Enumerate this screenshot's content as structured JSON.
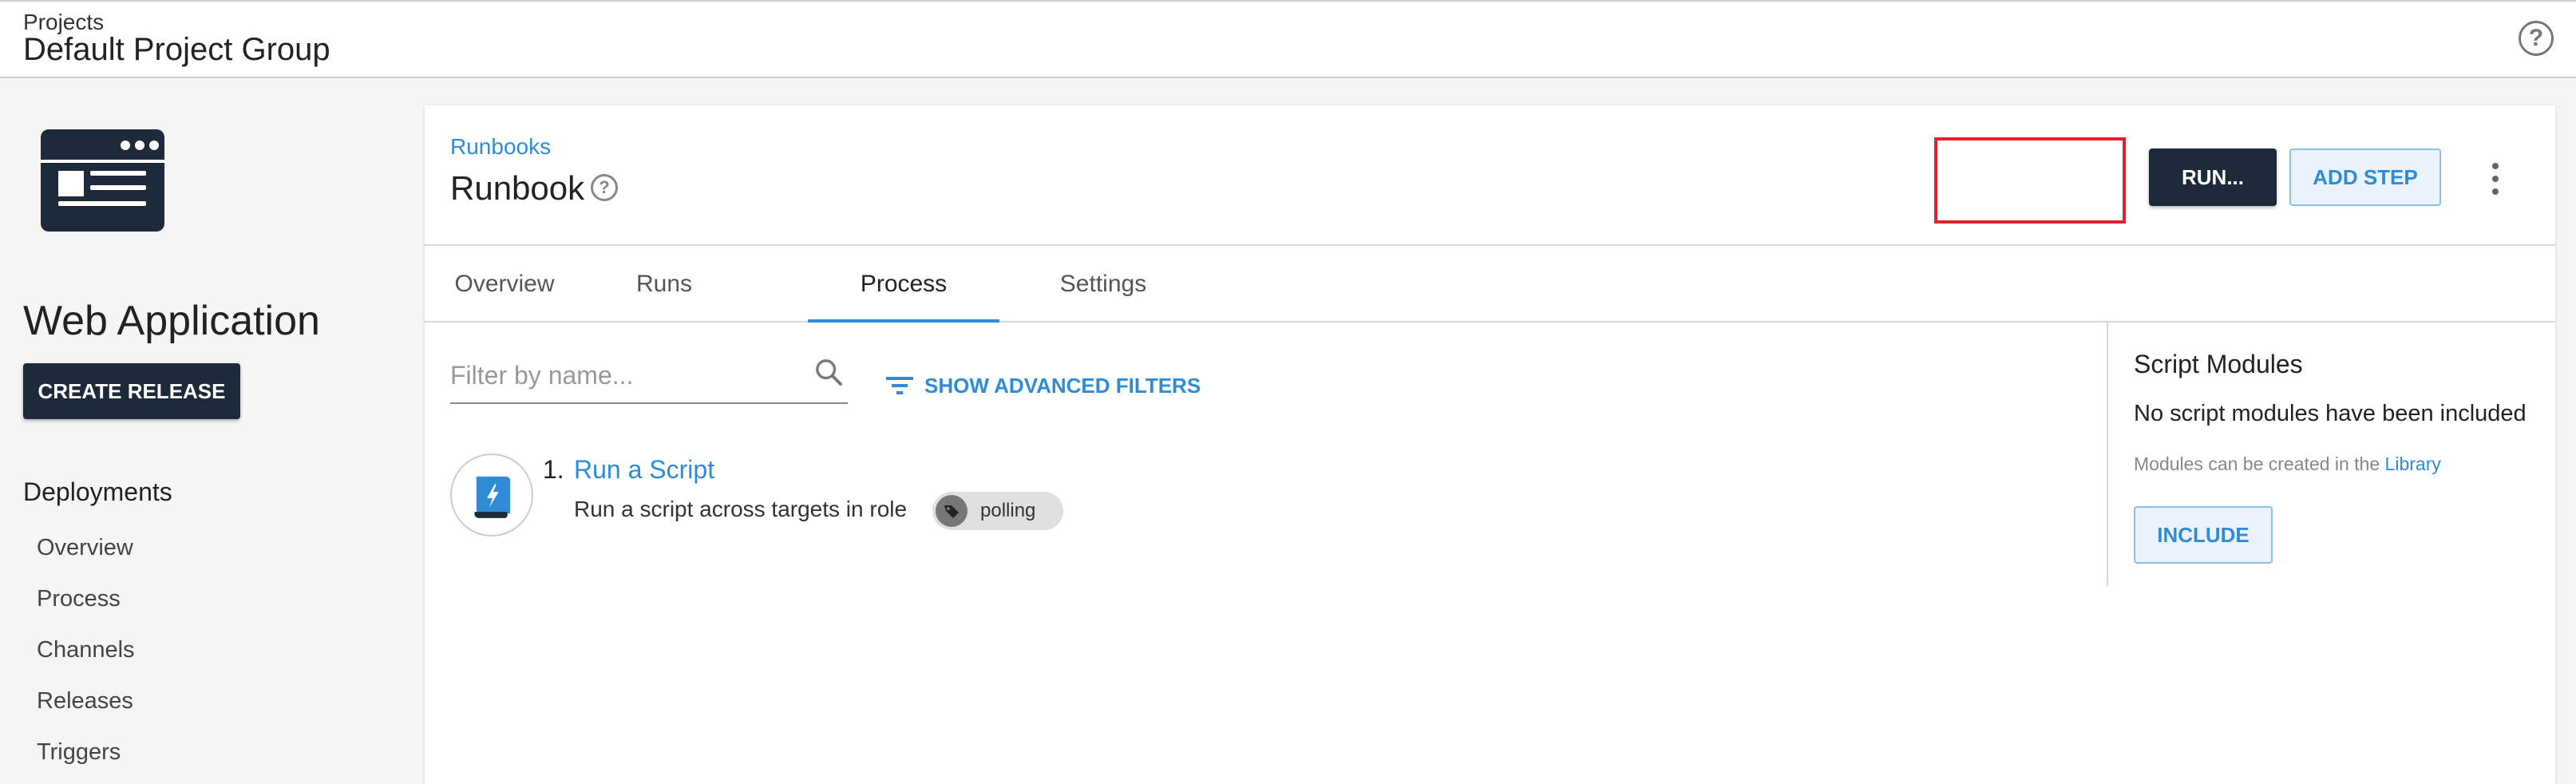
{
  "header": {
    "breadcrumb": "Projects",
    "title": "Default Project Group",
    "help_icon": "help-circle-icon"
  },
  "sidebar": {
    "logo_icon": "web-application-icon",
    "project_name": "Web Application",
    "create_release_label": "CREATE RELEASE",
    "nav_heading": "Deployments",
    "nav_items": [
      "Overview",
      "Process",
      "Channels",
      "Releases",
      "Triggers"
    ]
  },
  "runbook": {
    "breadcrumb": "Runbooks",
    "title": "Runbook",
    "run_label": "RUN...",
    "add_step_label": "ADD STEP",
    "tabs": [
      "Overview",
      "Runs",
      "Process",
      "Settings"
    ],
    "active_tab": "Process",
    "filter_placeholder": "Filter by name...",
    "advanced_filters_label": "SHOW ADVANCED FILTERS",
    "steps": [
      {
        "number": "1.",
        "name": "Run a Script",
        "description": "Run a script across targets in role",
        "tag": "polling",
        "icon": "script-icon"
      }
    ]
  },
  "script_modules": {
    "heading": "Script Modules",
    "empty_text": "No script modules have been included",
    "hint_text": "Modules can be created in the",
    "hint_link": "Library",
    "include_label": "INCLUDE"
  },
  "colors": {
    "accent": "#2f8bd6",
    "dark": "#1c2a3a",
    "highlight": "#e5202e"
  }
}
